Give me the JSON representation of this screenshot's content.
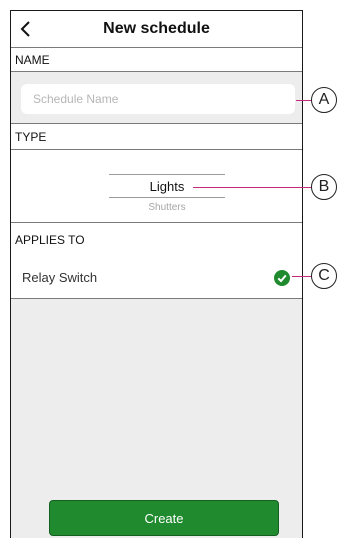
{
  "header": {
    "title": "New schedule",
    "back_icon": "chevron-left-icon"
  },
  "sections": {
    "name_label": "NAME",
    "type_label": "TYPE",
    "applies_label": "APPLIES TO"
  },
  "name_field": {
    "value": "",
    "placeholder": "Schedule Name"
  },
  "type_picker": {
    "selected": "Lights",
    "options": [
      "Lights",
      "Shutters"
    ],
    "other": "Shutters"
  },
  "device": {
    "label": "Relay Switch",
    "status_icon": "check-circle-icon",
    "checked": true
  },
  "actions": {
    "create_label": "Create"
  },
  "callouts": {
    "a": "A",
    "b": "B",
    "c": "C"
  },
  "colors": {
    "accent_green": "#1f8a2e",
    "callout_line": "#c6287a",
    "background_gray": "#ededed"
  }
}
